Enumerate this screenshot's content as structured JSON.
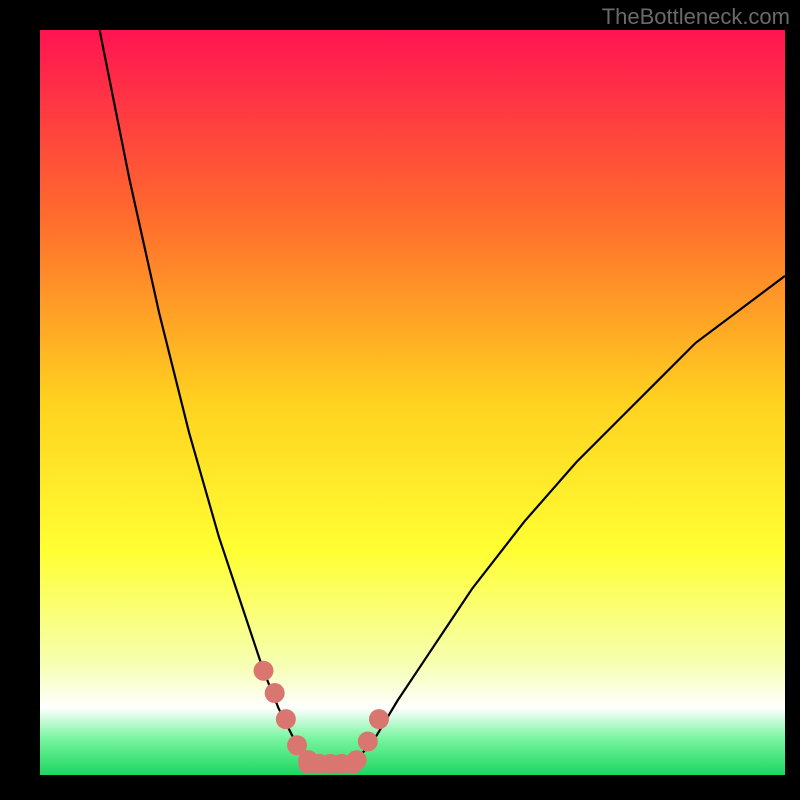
{
  "watermark": "TheBottleneck.com",
  "chart_data": {
    "type": "line",
    "title": "",
    "xlabel": "",
    "ylabel": "",
    "xlim": [
      0,
      100
    ],
    "ylim": [
      0,
      100
    ],
    "series": [
      {
        "name": "curve-left",
        "x": [
          8,
          12,
          16,
          20,
          24,
          28,
          30,
          32,
          34,
          35.5
        ],
        "y": [
          100,
          80,
          62,
          46,
          32,
          20,
          14,
          9,
          5,
          2
        ]
      },
      {
        "name": "curve-right",
        "x": [
          42.5,
          45,
          48,
          52,
          58,
          65,
          72,
          80,
          88,
          96,
          100
        ],
        "y": [
          2,
          5,
          10,
          16,
          25,
          34,
          42,
          50,
          58,
          64,
          67
        ]
      },
      {
        "name": "markers-left",
        "x": [
          30,
          31.5,
          33,
          34.5,
          36
        ],
        "y": [
          14,
          11,
          7.5,
          4,
          2
        ]
      },
      {
        "name": "markers-bottom",
        "x": [
          36,
          37.5,
          39,
          40.5,
          42
        ],
        "y": [
          1.5,
          1.5,
          1.5,
          1.5,
          1.5
        ]
      },
      {
        "name": "markers-right",
        "x": [
          42.5,
          44,
          45.5
        ],
        "y": [
          2,
          4.5,
          7.5
        ]
      }
    ],
    "gradient_stops": [
      {
        "offset": 0,
        "color": "#ff1452"
      },
      {
        "offset": 25,
        "color": "#ff6b2d"
      },
      {
        "offset": 50,
        "color": "#ffd21f"
      },
      {
        "offset": 70,
        "color": "#ffff33"
      },
      {
        "offset": 85,
        "color": "#f6ffb0"
      },
      {
        "offset": 91,
        "color": "#ffffff"
      },
      {
        "offset": 95,
        "color": "#7bf5a1"
      },
      {
        "offset": 100,
        "color": "#1bd65f"
      }
    ],
    "marker_color": "#d9766f",
    "marker_radius": 10
  },
  "layout": {
    "outer_w": 800,
    "outer_h": 800,
    "margin_left": 40,
    "margin_right": 15,
    "margin_top": 30,
    "margin_bottom": 25
  }
}
